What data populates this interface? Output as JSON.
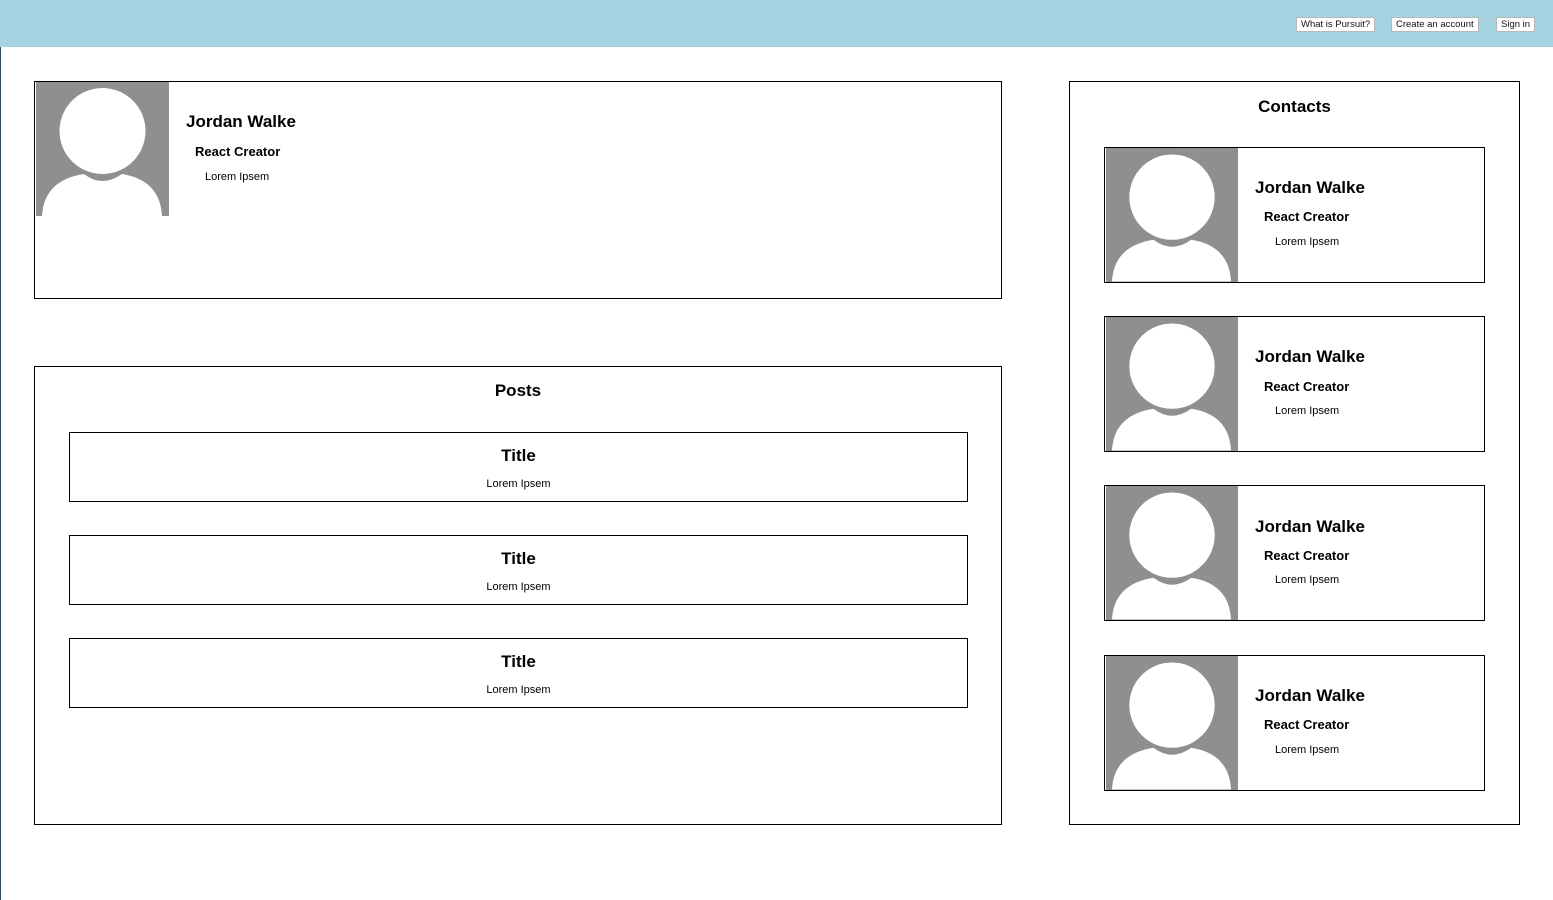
{
  "nav": {
    "what_is": "What is Pursuit?",
    "create_account": "Create an account",
    "sign_in": "Sign in"
  },
  "profile": {
    "name": "Jordan Walke",
    "role": "React Creator",
    "description": "Lorem Ipsem"
  },
  "posts": {
    "heading": "Posts",
    "items": [
      {
        "title": "Title",
        "body": "Lorem Ipsem"
      },
      {
        "title": "Title",
        "body": "Lorem Ipsem"
      },
      {
        "title": "Title",
        "body": "Lorem Ipsem"
      }
    ]
  },
  "contacts": {
    "heading": "Contacts",
    "items": [
      {
        "name": "Jordan Walke",
        "role": "React Creator",
        "description": "Lorem Ipsem"
      },
      {
        "name": "Jordan Walke",
        "role": "React Creator",
        "description": "Lorem Ipsem"
      },
      {
        "name": "Jordan Walke",
        "role": "React Creator",
        "description": "Lorem Ipsem"
      },
      {
        "name": "Jordan Walke",
        "role": "React Creator",
        "description": "Lorem Ipsem"
      }
    ]
  },
  "colors": {
    "header_bg": "#a5d3e2",
    "avatar_bg": "#8f8f8f"
  },
  "icons": {
    "avatar": "default-user-avatar-icon"
  }
}
